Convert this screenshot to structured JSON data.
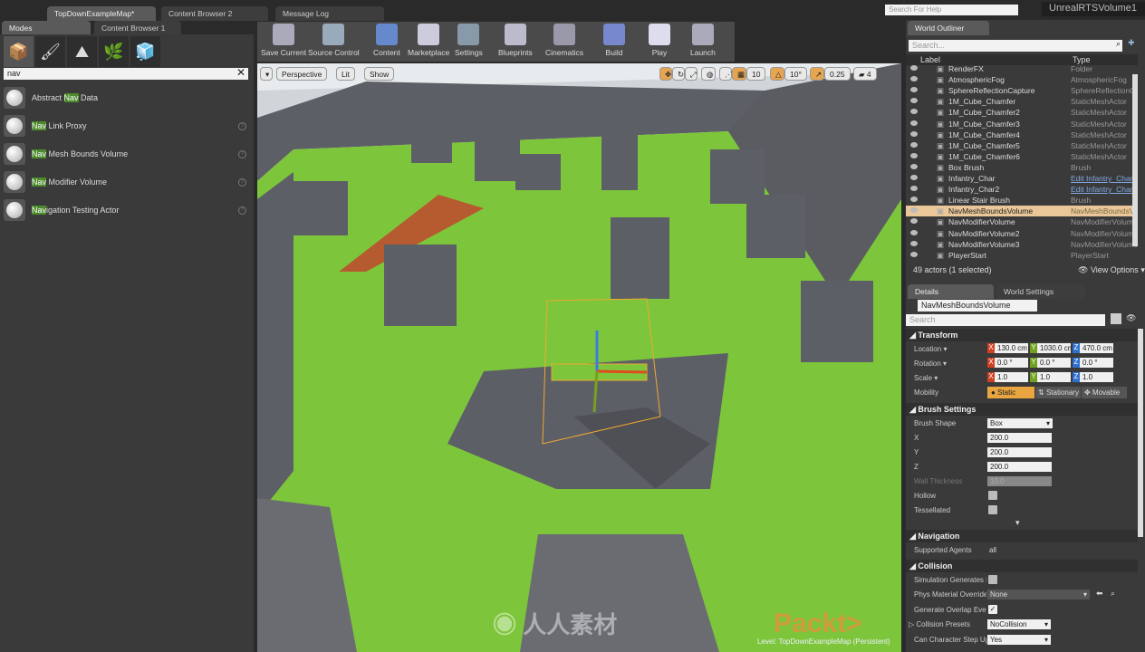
{
  "window": {
    "project": "UnrealRTSVolume1",
    "help_search_placeholder": "Search For Help"
  },
  "doc_tabs": [
    {
      "label": "TopDownExampleMap*"
    },
    {
      "label": "Content Browser 2"
    },
    {
      "label": "Message Log"
    }
  ],
  "left_panel": {
    "tabs": [
      {
        "label": "Modes"
      },
      {
        "label": "Content Browser 1"
      }
    ],
    "mode_icons": [
      "place-mode-icon",
      "paint-mode-icon",
      "landscape-mode-icon",
      "foliage-mode-icon",
      "geometry-mode-icon"
    ],
    "search_value": "nav",
    "items": [
      {
        "pre": "Abstract ",
        "hl": "Nav",
        "post": " Data"
      },
      {
        "pre": "",
        "hl": "Nav",
        "post": " Link Proxy"
      },
      {
        "pre": "",
        "hl": "Nav",
        "post": " Mesh Bounds Volume"
      },
      {
        "pre": "",
        "hl": "Nav",
        "post": " Modifier Volume"
      },
      {
        "pre": "",
        "hl": "Nav",
        "post": "igation Testing Actor"
      }
    ]
  },
  "toolbar": [
    {
      "label": "Save Current"
    },
    {
      "label": "Source Control"
    },
    {
      "label": "Content"
    },
    {
      "label": "Marketplace"
    },
    {
      "label": "Settings"
    },
    {
      "label": "Blueprints"
    },
    {
      "label": "Cinematics"
    },
    {
      "label": "Build"
    },
    {
      "label": "Play"
    },
    {
      "label": "Launch"
    }
  ],
  "viewport": {
    "view_mode": "Perspective",
    "lighting": "Lit",
    "show": "Show",
    "grid_snap": "10",
    "rotation_snap": "10°",
    "scale_snap": "0.25",
    "camera_speed": "4",
    "level_label": "Level:",
    "level_name": "TopDownExampleMap (Persistent)",
    "colors": {
      "floor": "#7dc63b",
      "blocks": "#5d5f66",
      "selection": "#f0a830"
    }
  },
  "outliner": {
    "tab": "World Outliner",
    "search_placeholder": "Search...",
    "col_label": "Label",
    "col_type": "Type",
    "rows": [
      {
        "label": "RenderFX",
        "type": "Folder"
      },
      {
        "label": "AtmosphericFog",
        "type": "AtmosphericFog"
      },
      {
        "label": "SphereReflectionCapture",
        "type": "SphereReflectionCa"
      },
      {
        "label": "1M_Cube_Chamfer",
        "type": "StaticMeshActor"
      },
      {
        "label": "1M_Cube_Chamfer2",
        "type": "StaticMeshActor"
      },
      {
        "label": "1M_Cube_Chamfer3",
        "type": "StaticMeshActor"
      },
      {
        "label": "1M_Cube_Chamfer4",
        "type": "StaticMeshActor"
      },
      {
        "label": "1M_Cube_Chamfer5",
        "type": "StaticMeshActor"
      },
      {
        "label": "1M_Cube_Chamfer6",
        "type": "StaticMeshActor"
      },
      {
        "label": "Box Brush",
        "type": "Brush"
      },
      {
        "label": "Infantry_Char",
        "type": "Edit Infantry_Char",
        "link": true
      },
      {
        "label": "Infantry_Char2",
        "type": "Edit Infantry_Char",
        "link": true
      },
      {
        "label": "Linear Stair Brush",
        "type": "Brush"
      },
      {
        "label": "NavMeshBoundsVolume",
        "type": "NavMeshBoundsVo",
        "selected": true
      },
      {
        "label": "NavModifierVolume",
        "type": "NavModifierVolume"
      },
      {
        "label": "NavModifierVolume2",
        "type": "NavModifierVolume"
      },
      {
        "label": "NavModifierVolume3",
        "type": "NavModifierVolume"
      },
      {
        "label": "PlayerStart",
        "type": "PlayerStart"
      }
    ],
    "status": "49 actors (1 selected)",
    "view_options": "View Options"
  },
  "details": {
    "tabs": [
      {
        "label": "Details"
      },
      {
        "label": "World Settings"
      }
    ],
    "actor_name": "NavMeshBoundsVolume",
    "search_placeholder": "Search",
    "transform": {
      "title": "Transform",
      "location_label": "Location",
      "location": [
        "130.0 cm",
        "1030.0 cm",
        "470.0 cm"
      ],
      "rotation_label": "Rotation",
      "rotation": [
        "0.0 °",
        "0.0 °",
        "0.0 °"
      ],
      "scale_label": "Scale",
      "scale": [
        "1.0",
        "1.0",
        "1.0"
      ],
      "mobility_label": "Mobility",
      "mobility_options": [
        "Static",
        "Stationary",
        "Movable"
      ],
      "mobility_selected": "Static"
    },
    "brush": {
      "title": "Brush Settings",
      "shape_label": "Brush Shape",
      "shape": "Box",
      "x_label": "X",
      "x": "200.0",
      "y_label": "Y",
      "y": "200.0",
      "z_label": "Z",
      "z": "200.0",
      "wall_label": "Wall Thickness",
      "wall": "10.0",
      "hollow_label": "Hollow",
      "hollow": false,
      "tess_label": "Tessellated",
      "tess": false
    },
    "navigation": {
      "title": "Navigation",
      "agents_label": "Supported Agents",
      "agents": "all"
    },
    "collision": {
      "title": "Collision",
      "sim_label": "Simulation Generates Hit Events",
      "sim": false,
      "phys_label": "Phys Material Override",
      "phys": "None",
      "overlap_label": "Generate Overlap Events",
      "overlap": true,
      "presets_label": "Collision Presets",
      "presets": "NoCollision",
      "step_label": "Can Character Step Up On",
      "step": "Yes"
    }
  },
  "watermark": {
    "logo_text": "Packt>",
    "site_text": "人人素材"
  }
}
